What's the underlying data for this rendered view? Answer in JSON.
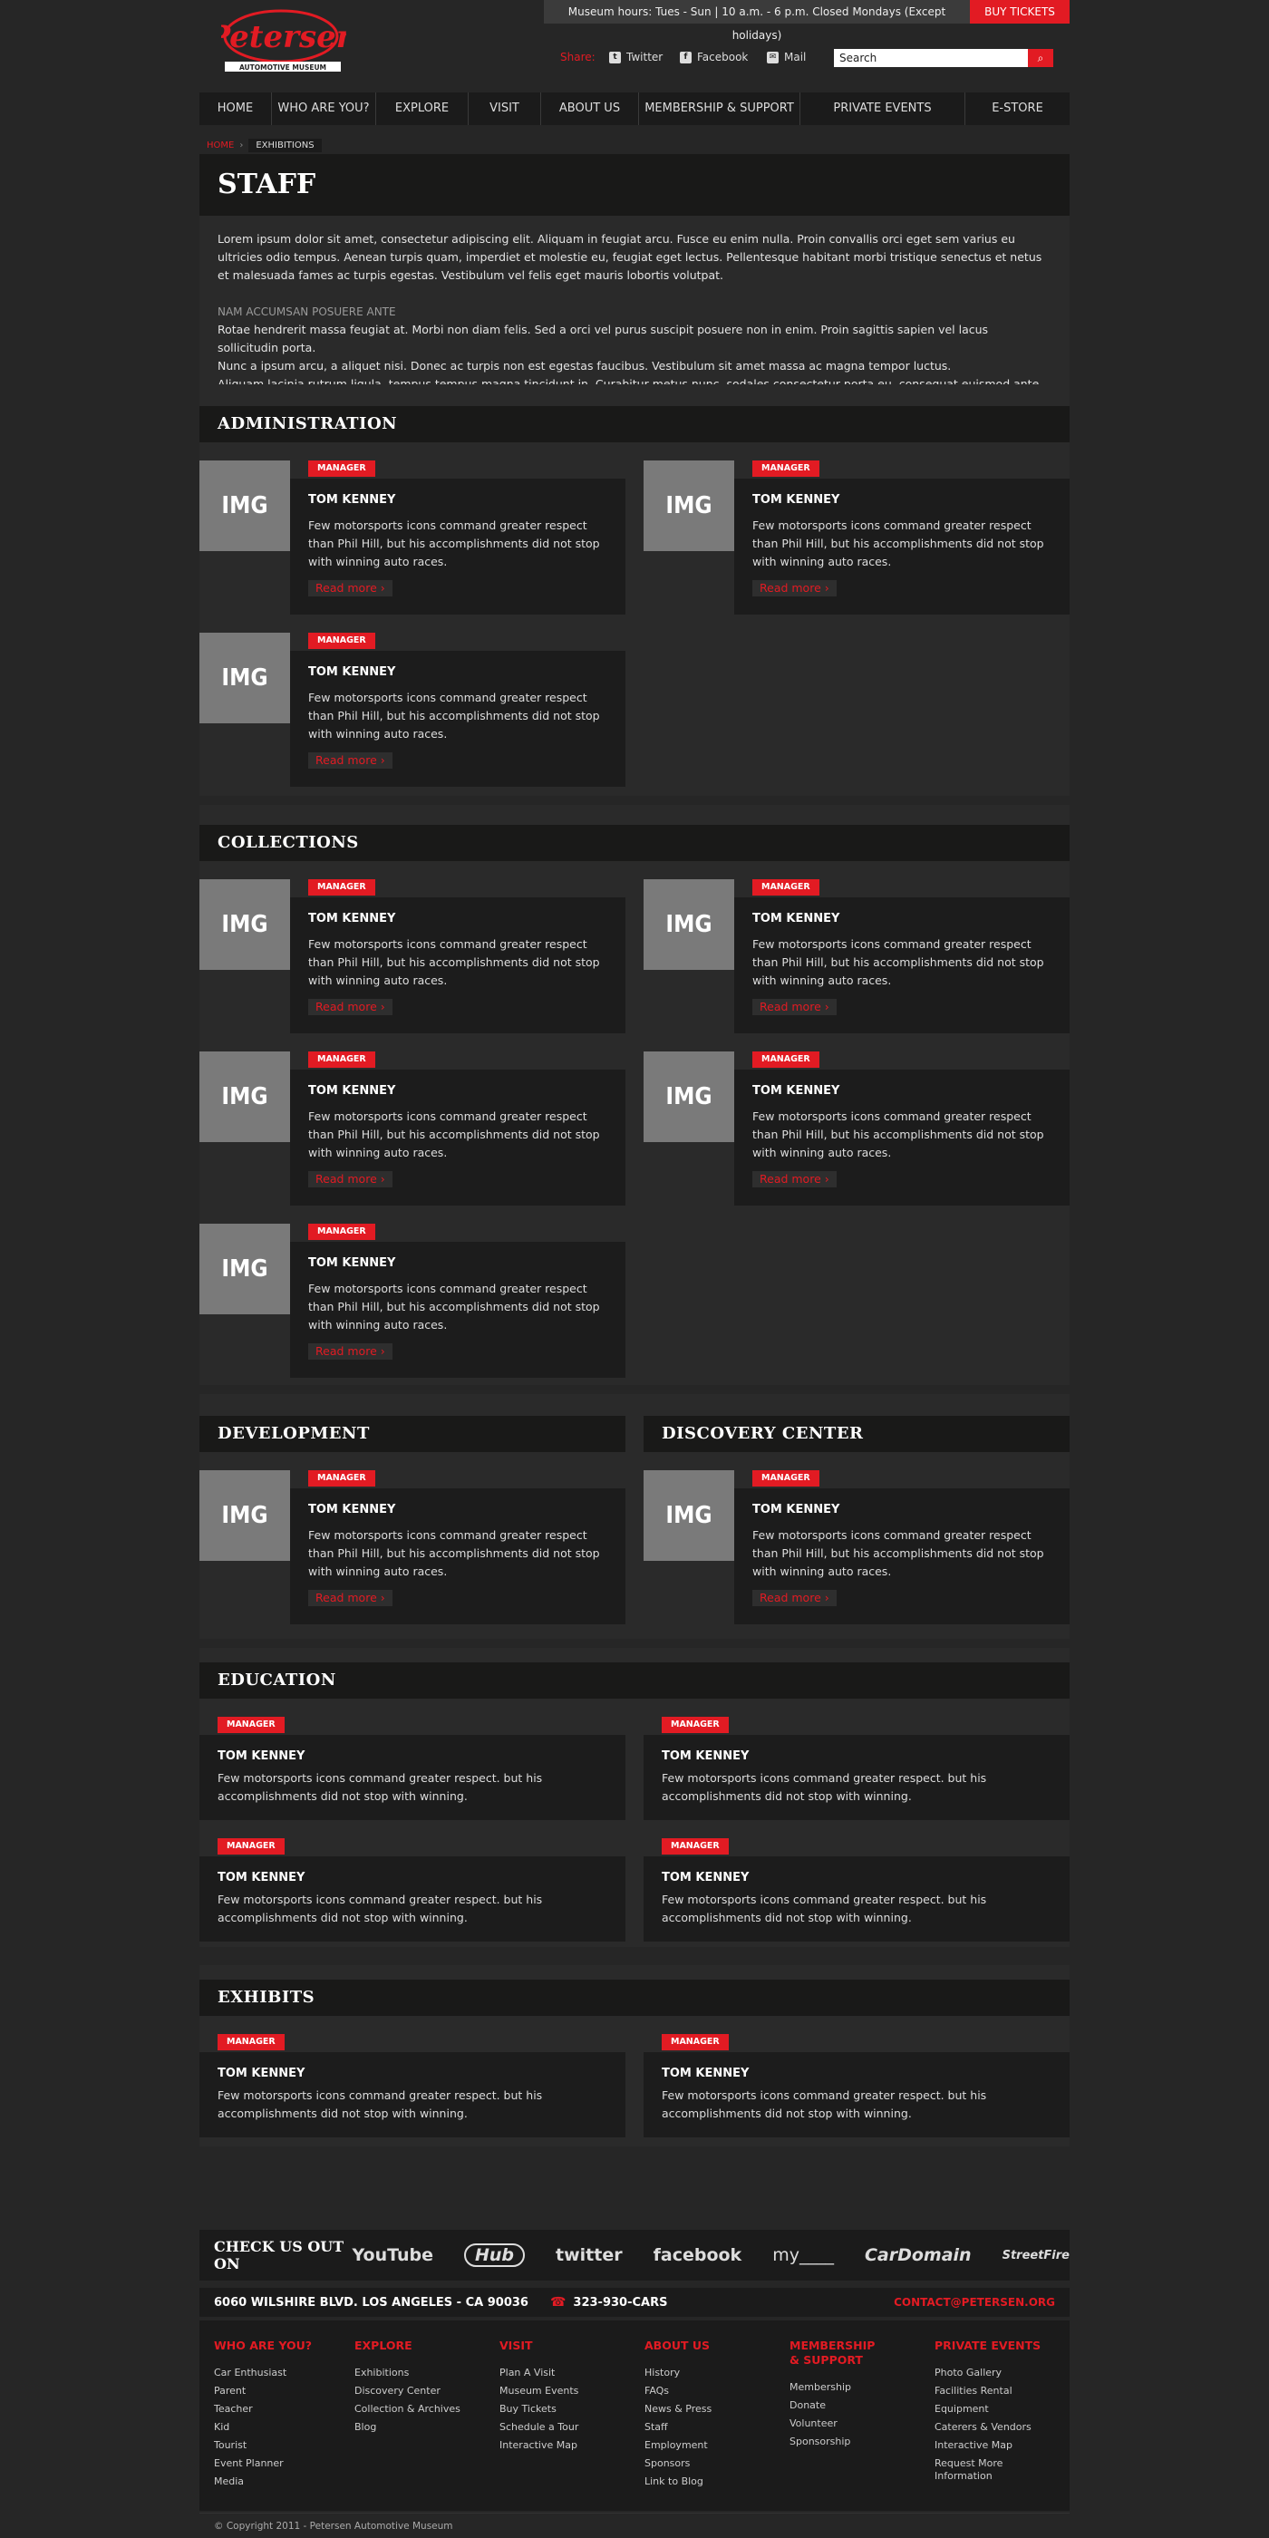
{
  "header": {
    "hours": "Museum hours: Tues - Sun | 10 a.m. - 6 p.m. Closed Mondays (Except holidays)",
    "buy_tickets": "BUY TICKETS",
    "logo_text": "Petersen",
    "logo_sub": "AUTOMOTIVE MUSEUM",
    "share_label": "Share:",
    "share_links": [
      {
        "label": "Twitter",
        "icon": "twitter-icon"
      },
      {
        "label": "Facebook",
        "icon": "facebook-icon"
      },
      {
        "label": "Mail",
        "icon": "mail-icon"
      }
    ],
    "search_value": "Search"
  },
  "nav": [
    "HOME",
    "WHO ARE YOU?",
    "EXPLORE",
    "VISIT",
    "ABOUT US",
    "MEMBERSHIP & SUPPORT",
    "PRIVATE EVENTS",
    "E-STORE"
  ],
  "breadcrumb": {
    "home": "HOME",
    "current": "EXHIBITIONS"
  },
  "page_title": "STAFF",
  "intro": {
    "p1": "Lorem ipsum dolor sit amet, consectetur adipiscing elit. Aliquam in feugiat arcu. Fusce eu enim nulla. Proin convallis orci eget sem varius eu ultricies odio tempus. Aenean turpis quam, imperdiet et molestie eu, feugiat eget lectus. Pellentesque habitant morbi tristique senectus et netus et malesuada fames ac turpis egestas. Vestibulum vel felis eget mauris lobortis volutpat.",
    "subhead": "NAM ACCUMSAN POSUERE ANTE",
    "p2": "Rotae hendrerit massa feugiat at. Morbi non diam felis. Sed a orci vel purus suscipit posuere non in enim. Proin sagittis sapien vel lacus sollicitudin porta.",
    "p3": "Nunc a ipsum arcu, a aliquet nisi. Donec ac turpis non est egestas faucibus. Vestibulum sit amet massa ac magna tempor luctus.",
    "p4": "Aliquam lacinia rutrum ligula, tempus tempus magna tincidunt in. Curabitur metus nunc, sodales consectetur porta eu, consequat euismod ante."
  },
  "card": {
    "img": "IMG",
    "badge": "MANAGER",
    "name": "TOM KENNEY",
    "desc": "Few motorsports icons command greater respect than Phil Hill, but his accomplishments did not stop with winning auto races.",
    "read_more": "Read more ›",
    "short_desc": "Few motorsports icons command greater respect. but his accomplishments did not stop with winning."
  },
  "sections": {
    "administration": "ADMINISTRATION",
    "collections": "COLLECTIONS",
    "development": "DEVELOPMENT",
    "discovery": "DISCOVERY CENTER",
    "education": "EDUCATION",
    "exhibits": "EXHIBITS"
  },
  "checkout": {
    "label": "CHECK US OUT ON",
    "networks": [
      "YouTube",
      "Hub",
      "twitter",
      "facebook",
      "my____",
      "CarDomain",
      "StreetFire"
    ]
  },
  "address": {
    "street": "6060 WILSHIRE BLVD. LOS ANGELES - CA 90036",
    "phone": "323-930-CARS",
    "email": "CONTACT@PETERSEN.ORG"
  },
  "footer": {
    "columns": [
      {
        "title": "WHO ARE YOU?",
        "items": [
          "Car Enthusiast",
          "Parent",
          "Teacher",
          "Kid",
          "Tourist",
          "Event Planner",
          "Media"
        ]
      },
      {
        "title": "EXPLORE",
        "items": [
          "Exhibitions",
          "Discovery Center",
          "Collection & Archives",
          "Blog"
        ]
      },
      {
        "title": "VISIT",
        "items": [
          "Plan A Visit",
          "Museum Events",
          "Buy Tickets",
          "Schedule a Tour",
          "Interactive Map"
        ]
      },
      {
        "title": "ABOUT US",
        "items": [
          "History",
          "FAQs",
          "News & Press",
          "Staff",
          "Employment",
          "Sponsors",
          "Link to Blog"
        ]
      },
      {
        "title": "MEMBERSHIP & SUPPORT",
        "items": [
          "Membership",
          "Donate",
          "Volunteer",
          "Sponsorship"
        ]
      },
      {
        "title": "PRIVATE EVENTS",
        "items": [
          "Photo Gallery",
          "Facilities Rental",
          "Equipment",
          "Caterers & Vendors",
          "Interactive Map",
          "Request More Information"
        ]
      }
    ],
    "copyright": "© Copyright 2011 - Petersen Automotive Museum"
  }
}
